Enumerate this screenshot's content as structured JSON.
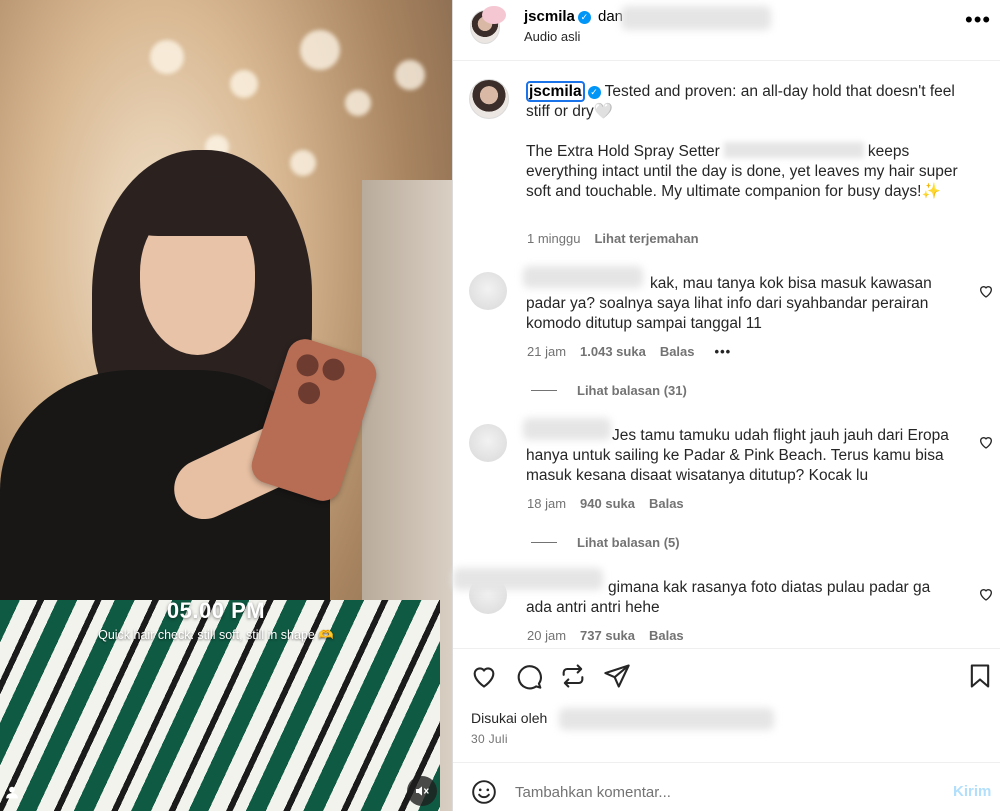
{
  "media": {
    "time_overlay": "05.00 PM",
    "caption_overlay": "Quick hair check: still soft, still in shape 🫶"
  },
  "header": {
    "username": "jscmila",
    "dan": "dan",
    "audio": "Audio asli",
    "more": "•••"
  },
  "caption": {
    "username": "jscmila",
    "line1": "Tested and proven: an all-day hold that doesn't feel stiff or dry🤍",
    "para2_start": "The Extra Hold Spray Setter",
    "para2_end": "keeps everything intact until the day is done, yet leaves my hair super soft and touchable. My ultimate companion for busy days!✨",
    "time": "1 minggu",
    "translate": "Lihat terjemahan"
  },
  "comments": [
    {
      "text": "kak, mau tanya kok bisa masuk kawasan padar ya? soalnya saya lihat info dari syahbandar perairan komodo ditutup sampai tanggal 11",
      "time": "21 jam",
      "likes": "1.043 suka",
      "reply": "Balas",
      "more": "•••",
      "view_replies": "Lihat balasan (31)"
    },
    {
      "text": "Jes tamu tamuku udah flight jauh jauh dari Eropa hanya untuk sailing ke Padar & Pink Beach. Terus kamu bisa masuk kesana disaat wisatanya ditutup? Kocak lu",
      "time": "18 jam",
      "likes": "940 suka",
      "reply": "Balas",
      "view_replies": "Lihat balasan (5)"
    },
    {
      "text": "gimana kak rasanya foto diatas pulau padar ga ada antri antri hehe",
      "time": "20 jam",
      "likes": "737 suka",
      "reply": "Balas"
    }
  ],
  "footer": {
    "liked_by": "Disukai oleh",
    "date": "30 Juli",
    "comment_placeholder": "Tambahkan komentar...",
    "post": "Kirim"
  },
  "colors": {
    "verified": "#0095f6",
    "secondary_text": "#737373",
    "post_disabled": "#b2dffc"
  }
}
